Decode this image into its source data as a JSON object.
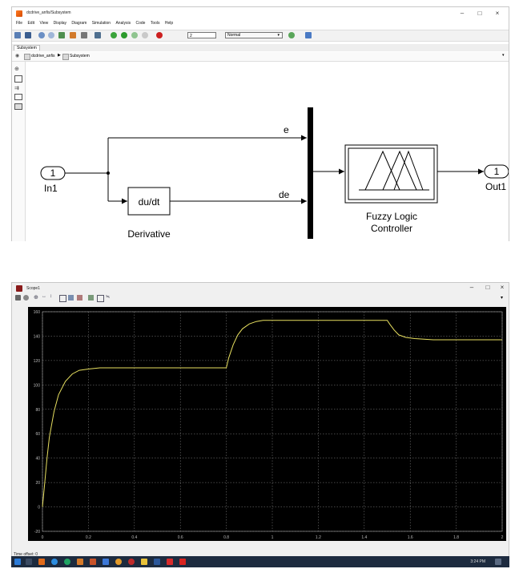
{
  "simulink": {
    "title": "dcdrive_anfis/Subsystem",
    "menu": [
      "File",
      "Edit",
      "View",
      "Display",
      "Diagram",
      "Simulation",
      "Analysis",
      "Code",
      "Tools",
      "Help"
    ],
    "stop_time": "2",
    "sim_mode": "Normal",
    "tab": "Subsystem",
    "breadcrumb": [
      "dcdrive_anfis",
      "Subsystem"
    ],
    "blocks": {
      "in1_port": "1",
      "in1_label": "In1",
      "derivative_text": "du/dt",
      "derivative_label": "Derivative",
      "fuzzy_label_1": "Fuzzy Logic",
      "fuzzy_label_2": "Controller",
      "out1_port": "1",
      "out1_label": "Out1",
      "signal_e": "e",
      "signal_de": "de"
    }
  },
  "scope": {
    "title": "Scope1",
    "time_offset": "Time offset:  0",
    "chart_data": {
      "type": "line",
      "xlim": [
        0,
        2
      ],
      "ylim": [
        -20,
        160
      ],
      "xticks": [
        "0",
        "0.2",
        "0.4",
        "0.6",
        "0.8",
        "1",
        "1.2",
        "1.4",
        "1.6",
        "1.8",
        "2"
      ],
      "yticks": [
        "-20",
        "0",
        "20",
        "40",
        "60",
        "80",
        "100",
        "120",
        "140",
        "160"
      ],
      "grid": true,
      "line_color": "#e8e060",
      "series": [
        {
          "x": [
            0,
            0.01,
            0.02,
            0.03,
            0.05,
            0.07,
            0.1,
            0.13,
            0.16,
            0.2,
            0.25,
            0.3,
            0.4,
            0.6,
            0.8,
            0.81,
            0.83,
            0.85,
            0.87,
            0.9,
            0.93,
            0.96,
            1.0,
            1.1,
            1.4,
            1.5,
            1.51,
            1.53,
            1.55,
            1.58,
            1.62,
            1.7,
            1.8,
            2.0
          ],
          "y": [
            0,
            20,
            40,
            57,
            78,
            92,
            103,
            109,
            112,
            113,
            114,
            114,
            114,
            114,
            114,
            122,
            133,
            141,
            146,
            150,
            152,
            153,
            153,
            153,
            153,
            153,
            150,
            145,
            141,
            139,
            138,
            137,
            137,
            137
          ]
        }
      ]
    }
  },
  "taskbar": {
    "time": "3:24 PM"
  }
}
